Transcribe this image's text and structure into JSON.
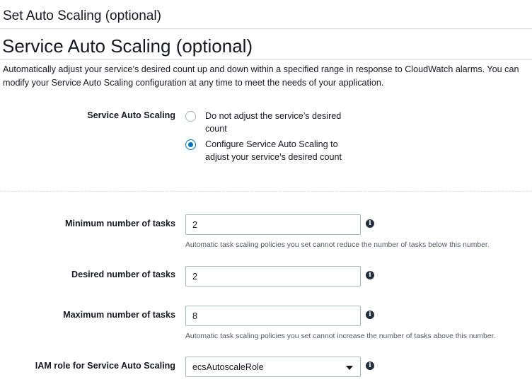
{
  "page": {
    "heading": "Set Auto Scaling (optional)"
  },
  "section": {
    "title": "Service Auto Scaling (optional)",
    "description": "Automatically adjust your service’s desired count up and down within a specified range in response to CloudWatch alarms. You can modify your Service Auto Scaling configuration at any time to meet the needs of your application."
  },
  "service_auto_scaling": {
    "label": "Service Auto Scaling",
    "options": [
      {
        "label": "Do not adjust the service’s desired count",
        "selected": false
      },
      {
        "label": "Configure Service Auto Scaling to adjust your service’s desired count",
        "selected": true
      }
    ]
  },
  "fields": {
    "minimum": {
      "label": "Minimum number of tasks",
      "value": "2",
      "hint": "Automatic task scaling policies you set cannot reduce the number of tasks below this number."
    },
    "desired": {
      "label": "Desired number of tasks",
      "value": "2"
    },
    "maximum": {
      "label": "Maximum number of tasks",
      "value": "8",
      "hint": "Automatic task scaling policies you set cannot increase the number of tasks above this number."
    },
    "iam_role": {
      "label": "IAM role for Service Auto Scaling",
      "selected": "ecsAutoscaleRole"
    }
  },
  "icons": {
    "info": "info-icon",
    "radio": "radio-button",
    "dropdown": "caret-down-icon"
  },
  "colors": {
    "accent": "#0073bb",
    "text": "#16191f",
    "hint": "#545b64",
    "border": "#aab7b8",
    "divider": "#d5dbdb"
  }
}
